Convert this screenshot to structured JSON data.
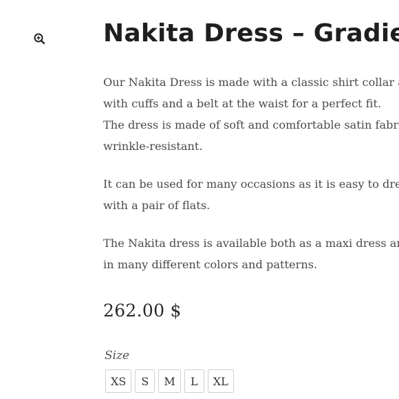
{
  "product": {
    "title": "Nakita Dress – Gradient",
    "description": [
      [
        "Our Nakita Dress is made with a classic shirt collar and sleeves",
        "with cuffs and a belt at the waist for a perfect fit.",
        "The dress is made of soft and comfortable satin fabric that is",
        "wrinkle-resistant."
      ],
      [
        "It can be used for many occasions as it is easy to dress up or down",
        "with a pair of flats."
      ],
      [
        "The Nakita dress is available both as a maxi dress and a midi dress",
        "in many different colors and patterns."
      ]
    ],
    "price": "262.00 $",
    "size_label": "Size",
    "sizes": [
      "XS",
      "S",
      "M",
      "L",
      "XL"
    ]
  },
  "icons": {
    "zoom": "zoom-in-icon"
  }
}
